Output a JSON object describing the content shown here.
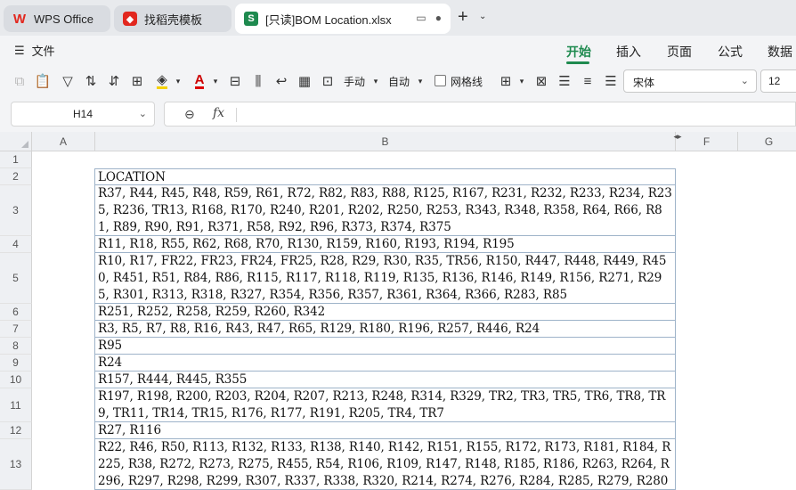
{
  "tabs": [
    {
      "label": "WPS Office",
      "icon": "wps-logo-icon"
    },
    {
      "label": "找稻壳模板",
      "icon": "docer-logo-icon"
    },
    {
      "label": "[只读]BOM Location.xlsx",
      "icon": "spreadsheet-logo-icon",
      "logo_letter": "S",
      "active": true
    }
  ],
  "menu": {
    "file_label": "文件",
    "ribbon_tabs": [
      "开始",
      "插入",
      "页面",
      "公式",
      "数据"
    ],
    "active_tab": "开始"
  },
  "toolbar": {
    "wrap_mode_label": "手动",
    "autofit_label": "自动",
    "gridlines_label": "网格线",
    "font_name": "宋体",
    "font_size": "12"
  },
  "formula_bar": {
    "cell_ref": "H14",
    "fx_label": "fx",
    "content": ""
  },
  "columns": [
    "A",
    "B",
    "F",
    "G"
  ],
  "rows": [
    {
      "num": "1",
      "text": ""
    },
    {
      "num": "2",
      "text": "LOCATION"
    },
    {
      "num": "3",
      "text": "R37, R44, R45, R48, R59, R61, R72, R82, R83, R88, R125, R167, R231, R232, R233, R234, R235, R236, TR13, R168, R170, R240, R201, R202, R250, R253, R343, R348, R358, R64, R66, R81, R89, R90, R91, R371, R58, R92, R96, R373, R374, R375"
    },
    {
      "num": "4",
      "text": "R11, R18, R55, R62, R68, R70, R130, R159, R160, R193, R194, R195"
    },
    {
      "num": "5",
      "text": "R10, R17, FR22, FR23, FR24, FR25, R28, R29, R30, R35, TR56, R150, R447, R448, R449, R450, R451, R51, R84, R86, R115, R117, R118, R119, R135, R136, R146, R149, R156, R271, R295, R301, R313, R318, R327, R354, R356, R357, R361, R364, R366, R283, R85"
    },
    {
      "num": "6",
      "text": "R251, R252, R258, R259, R260, R342"
    },
    {
      "num": "7",
      "text": "R3, R5, R7, R8, R16, R43, R47, R65, R129, R180, R196, R257, R446, R24"
    },
    {
      "num": "8",
      "text": "R95"
    },
    {
      "num": "9",
      "text": "R24"
    },
    {
      "num": "10",
      "text": "R157, R444, R445, R355"
    },
    {
      "num": "11",
      "text": "R197, R198, R200, R203, R204, R207, R213, R248, R314, R329, TR2, TR3, TR5, TR6, TR8, TR9, TR11, TR14, TR15, R176, R177, R191, R205, TR4, TR7"
    },
    {
      "num": "12",
      "text": "R27, R116"
    },
    {
      "num": "13",
      "text": "R22, R46, R50, R113, R132, R133, R138, R140, R142, R151, R155, R172, R173, R181, R184, R225, R38, R272, R273, R275, R455, R54, R106, R109, R147, R148, R185, R186, R263, R264, R296, R297, R298, R299, R307, R337, R338, R320, R214, R274, R276, R284, R285, R279, R280"
    }
  ],
  "colors": {
    "accent": "#1e8a4f",
    "tab_bar": "#e8eaed",
    "cell_border": "#9eb3c9"
  }
}
